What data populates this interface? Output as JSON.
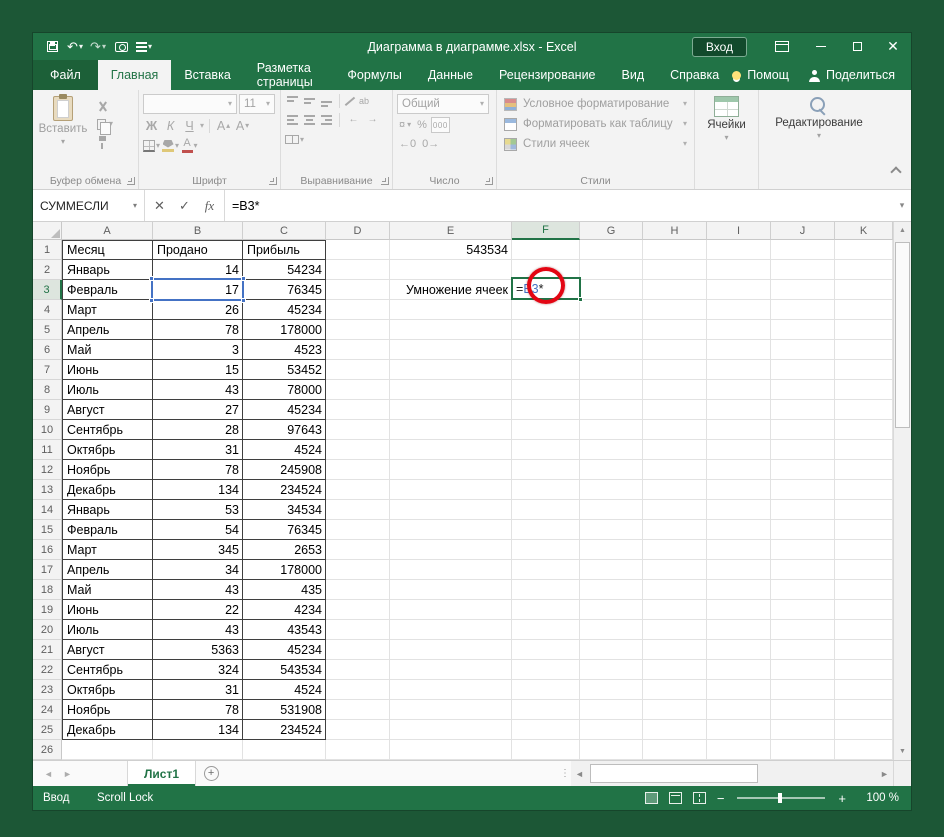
{
  "window": {
    "title": "Диаграмма в диаграмме.xlsx  -  Excel",
    "signin": "Вход"
  },
  "menu": {
    "file": "Файл",
    "tabs": [
      "Главная",
      "Вставка",
      "Разметка страницы",
      "Формулы",
      "Данные",
      "Рецензирование",
      "Вид",
      "Справка"
    ],
    "active_tab": "Главная",
    "assistant": "Помощ",
    "share": "Поделиться"
  },
  "ribbon": {
    "clipboard": {
      "label": "Буфер обмена",
      "paste": "Вставить"
    },
    "font": {
      "label": "Шрифт",
      "size": "11",
      "bold": "Ж",
      "italic": "К",
      "underline": "Ч"
    },
    "alignment": {
      "label": "Выравнивание"
    },
    "number": {
      "label": "Число",
      "format": "Общий",
      "percent": "%",
      "thousands": "000"
    },
    "styles": {
      "label": "Стили",
      "buttons": [
        "Условное форматирование",
        "Форматировать как таблицу",
        "Стили ячеек"
      ]
    },
    "cells": {
      "label": "Ячейки"
    },
    "editing": {
      "label": "Редактирование"
    }
  },
  "formula_bar": {
    "name_box": "СУММЕСЛИ",
    "formula": "=B3*",
    "fx": "fx"
  },
  "sheet": {
    "columns": [
      "A",
      "B",
      "C",
      "D",
      "E",
      "F",
      "G",
      "H",
      "I",
      "J",
      "K"
    ],
    "active_cell": {
      "column": "F",
      "row": 3,
      "parts": [
        {
          "text": "=",
          "color": "#1a1a1a"
        },
        {
          "text": "B3",
          "color": "#4472c4"
        },
        {
          "text": "*",
          "color": "#1a1a1a"
        }
      ]
    },
    "reference_cell": {
      "column": "B",
      "row": 3
    },
    "rows": [
      {
        "n": "1",
        "A": "Месяц",
        "B": "Продано",
        "C": "Прибыль",
        "E": "543534"
      },
      {
        "n": "2",
        "A": "Январь",
        "B": "14",
        "C": "54234"
      },
      {
        "n": "3",
        "A": "Февраль",
        "B": "17",
        "C": "76345",
        "E": "Умножение ячеек"
      },
      {
        "n": "4",
        "A": "Март",
        "B": "26",
        "C": "45234"
      },
      {
        "n": "5",
        "A": "Апрель",
        "B": "78",
        "C": "178000"
      },
      {
        "n": "6",
        "A": "Май",
        "B": "3",
        "C": "4523"
      },
      {
        "n": "7",
        "A": "Июнь",
        "B": "15",
        "C": "53452"
      },
      {
        "n": "8",
        "A": "Июль",
        "B": "43",
        "C": "78000"
      },
      {
        "n": "9",
        "A": "Август",
        "B": "27",
        "C": "45234"
      },
      {
        "n": "10",
        "A": "Сентябрь",
        "B": "28",
        "C": "97643"
      },
      {
        "n": "11",
        "A": "Октябрь",
        "B": "31",
        "C": "4524"
      },
      {
        "n": "12",
        "A": "Ноябрь",
        "B": "78",
        "C": "245908"
      },
      {
        "n": "13",
        "A": "Декабрь",
        "B": "134",
        "C": "234524"
      },
      {
        "n": "14",
        "A": "Январь",
        "B": "53",
        "C": "34534"
      },
      {
        "n": "15",
        "A": "Февраль",
        "B": "54",
        "C": "76345"
      },
      {
        "n": "16",
        "A": "Март",
        "B": "345",
        "C": "2653"
      },
      {
        "n": "17",
        "A": "Апрель",
        "B": "34",
        "C": "178000"
      },
      {
        "n": "18",
        "A": "Май",
        "B": "43",
        "C": "435"
      },
      {
        "n": "19",
        "A": "Июнь",
        "B": "22",
        "C": "4234"
      },
      {
        "n": "20",
        "A": "Июль",
        "B": "43",
        "C": "43543"
      },
      {
        "n": "21",
        "A": "Август",
        "B": "5363",
        "C": "45234"
      },
      {
        "n": "22",
        "A": "Сентябрь",
        "B": "324",
        "C": "543534"
      },
      {
        "n": "23",
        "A": "Октябрь",
        "B": "31",
        "C": "4524"
      },
      {
        "n": "24",
        "A": "Ноябрь",
        "B": "78",
        "C": "531908"
      },
      {
        "n": "25",
        "A": "Декабрь",
        "B": "134",
        "C": "234524"
      },
      {
        "n": "26"
      }
    ]
  },
  "sheet_tabs": {
    "tabs": [
      "Лист1"
    ],
    "active": "Лист1"
  },
  "status_bar": {
    "mode": "Ввод",
    "scroll_lock": "Scroll Lock",
    "zoom_level": "100 %"
  },
  "colors": {
    "accent": "#217346",
    "reference_border": "#4472c4",
    "annotation": "#e30613"
  }
}
